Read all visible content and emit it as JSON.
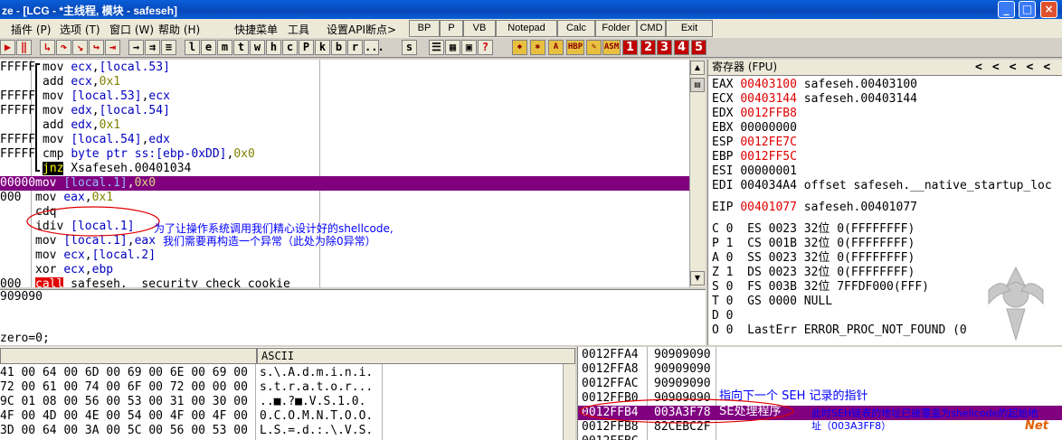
{
  "title": "ze - [LCG - *主线程, 模块 - safeseh]",
  "window_buttons": {
    "min": "_",
    "max": "□",
    "close": "×"
  },
  "menu": [
    "插件 (P)",
    "选项 (T)",
    "窗口 (W)",
    "帮助 (H)",
    "快捷菜单",
    "工具",
    "设置API断点>"
  ],
  "menu_buttons": [
    "BP",
    "P",
    "VB",
    "Notepad",
    "Calc",
    "Folder",
    "CMD",
    "Exit"
  ],
  "toolbar": {
    "letters": [
      "l",
      "e",
      "m",
      "t",
      "w",
      "h",
      "c",
      "P",
      "k",
      "b",
      "r",
      "...",
      "s"
    ],
    "plugins": [
      "HBP",
      "ASM"
    ],
    "numbers": [
      "1",
      "2",
      "3",
      "4",
      "5"
    ]
  },
  "disasm": [
    {
      "addr": "FFFFF",
      "tokens": [
        [
          "mov ",
          "blk"
        ],
        [
          "ecx",
          "blu"
        ],
        [
          ",",
          "blk"
        ],
        [
          "[local.53]",
          "blu"
        ]
      ]
    },
    {
      "addr": "",
      "tokens": [
        [
          "add ",
          "blk"
        ],
        [
          "ecx",
          "blu"
        ],
        [
          ",",
          "blk"
        ],
        [
          "0x1",
          "olv"
        ]
      ]
    },
    {
      "addr": "FFFFF",
      "tokens": [
        [
          "mov ",
          "blk"
        ],
        [
          "[local.53]",
          "blu"
        ],
        [
          ",",
          "blk"
        ],
        [
          "ecx",
          "blu"
        ]
      ]
    },
    {
      "addr": "FFFFF",
      "tokens": [
        [
          "mov ",
          "blk"
        ],
        [
          "edx",
          "blu"
        ],
        [
          ",",
          "blk"
        ],
        [
          "[local.54]",
          "blu"
        ]
      ]
    },
    {
      "addr": "",
      "tokens": [
        [
          "add ",
          "blk"
        ],
        [
          "edx",
          "blu"
        ],
        [
          ",",
          "blk"
        ],
        [
          "0x1",
          "olv"
        ]
      ]
    },
    {
      "addr": "FFFFF",
      "tokens": [
        [
          "mov ",
          "blk"
        ],
        [
          "[local.54]",
          "blu"
        ],
        [
          ",",
          "blk"
        ],
        [
          "edx",
          "blu"
        ]
      ]
    },
    {
      "addr": "FFFFF",
      "tokens": [
        [
          "cmp ",
          "blk"
        ],
        [
          "byte ptr ss:[ebp-0xDD]",
          "blu"
        ],
        [
          ",",
          "blk"
        ],
        [
          "0x0",
          "olv"
        ]
      ]
    },
    {
      "addr": "",
      "tokens": [
        [
          "jnz",
          "jnz"
        ],
        [
          " Xsafeseh.00401034",
          "blk"
        ]
      ]
    },
    {
      "addr": "00000",
      "tokens": [
        [
          "mov ",
          "blk"
        ],
        [
          "[local.1]",
          "blu"
        ],
        [
          ",",
          "blk"
        ],
        [
          "0x0",
          "olv"
        ]
      ],
      "sel": true
    },
    {
      "addr": "000",
      "tokens": [
        [
          "mov ",
          "blk"
        ],
        [
          "eax",
          "blu"
        ],
        [
          ",",
          "blk"
        ],
        [
          "0x1",
          "olv"
        ]
      ]
    },
    {
      "addr": "",
      "tokens": [
        [
          "cdq",
          "blk"
        ]
      ]
    },
    {
      "addr": "",
      "tokens": [
        [
          "idiv ",
          "blk"
        ],
        [
          "[local.1]",
          "blu"
        ]
      ]
    },
    {
      "addr": "",
      "tokens": [
        [
          "mov ",
          "blk"
        ],
        [
          "[local.1]",
          "blu"
        ],
        [
          ",",
          "blk"
        ],
        [
          "eax",
          "blu"
        ]
      ]
    },
    {
      "addr": "",
      "tokens": [
        [
          "mov ",
          "blk"
        ],
        [
          "ecx",
          "blu"
        ],
        [
          ",",
          "blk"
        ],
        [
          "[local.2]",
          "blu"
        ]
      ]
    },
    {
      "addr": "",
      "tokens": [
        [
          "xor ",
          "blk"
        ],
        [
          "ecx",
          "blu"
        ],
        [
          ",",
          "blk"
        ],
        [
          "ebp",
          "blu"
        ]
      ]
    },
    {
      "addr": "000",
      "tokens": [
        [
          "call",
          "call"
        ],
        [
          " safeseh.__security_check_cookie",
          "blk"
        ]
      ]
    }
  ],
  "annotations": {
    "idiv_note_1": "为了让操作系统调用我们精心设计好的shellcode,",
    "idiv_note_2": "我们需要再构造一个异常（此处为除0异常）",
    "seh_next": "指向下一个 SEH 记录的指针",
    "seh_handler": "SE处理程序",
    "seh_note_1": "此时SEH链表的地址已被覆盖为shellcode的起始地",
    "seh_note_2": "址（003A3FF8）"
  },
  "info_pane": {
    "line1": "909090",
    "line2": "zero=0;"
  },
  "registers": {
    "header": "寄存器 (FPU)",
    "nav": [
      "<",
      "<",
      "<",
      "<",
      "<"
    ],
    "rows": [
      {
        "name": "EAX",
        "value": "00403100",
        "changed": true,
        "comment": "safeseh.00403100"
      },
      {
        "name": "ECX",
        "value": "00403144",
        "changed": true,
        "comment": "safeseh.00403144"
      },
      {
        "name": "EDX",
        "value": "0012FFB8",
        "changed": true,
        "comment": ""
      },
      {
        "name": "EBX",
        "value": "00000000",
        "changed": false,
        "comment": ""
      },
      {
        "name": "ESP",
        "value": "0012FE7C",
        "changed": true,
        "comment": ""
      },
      {
        "name": "EBP",
        "value": "0012FF5C",
        "changed": true,
        "comment": ""
      },
      {
        "name": "ESI",
        "value": "00000001",
        "changed": false,
        "comment": ""
      },
      {
        "name": "EDI",
        "value": "004034A4",
        "changed": false,
        "comment": "offset safeseh.__native_startup_loc"
      }
    ],
    "eip": {
      "name": "EIP",
      "value": "00401077",
      "comment": "safeseh.00401077"
    },
    "flags": [
      "C 0  ES 0023 32位 0(FFFFFFFF)",
      "P 1  CS 001B 32位 0(FFFFFFFF)",
      "A 0  SS 0023 32位 0(FFFFFFFF)",
      "Z 1  DS 0023 32位 0(FFFFFFFF)",
      "S 0  FS 003B 32位 7FFDF000(FFF)",
      "T 0  GS 0000 NULL",
      "D 0",
      "O 0  LastErr ERROR_PROC_NOT_FOUND (0"
    ]
  },
  "dump": {
    "ascii_header": "ASCII",
    "rows": [
      {
        "hex": "41 00 64 00 6D 00 69 00 6E 00 69 00",
        "ascii": "s.\\.A.d.m.i.n.i."
      },
      {
        "hex": "72 00 61 00 74 00 6F 00 72 00 00 00",
        "ascii": "s.t.r.a.t.o.r..."
      },
      {
        "hex": "9C 01 08 00 56 00 53 00 31 00 30 00",
        "ascii": "..■.?■.V.S.1.0."
      },
      {
        "hex": "4F 00 4D 00 4E 00 54 00 4F 00 4F 00",
        "ascii": "0.C.O.M.N.T.O.O."
      },
      {
        "hex": "3D 00 64 00 3A 00 5C 00 56 00 53 00",
        "ascii": "L.S.=.d.:.\\.V.S."
      }
    ]
  },
  "stack": [
    {
      "addr": "0012FFA4",
      "value": "90909090"
    },
    {
      "addr": "0012FFA8",
      "value": "90909090"
    },
    {
      "addr": "0012FFAC",
      "value": "90909090"
    },
    {
      "addr": "0012FFB0",
      "value": "90909090"
    },
    {
      "addr": "0012FFB4",
      "value": "003A3F78",
      "sel": true
    },
    {
      "addr": "0012FFB8",
      "value": "82CEBC2F"
    },
    {
      "addr": "0012FFBC",
      "value": ""
    }
  ],
  "watermark": "Net",
  "colors": {
    "select": "#800080",
    "title": "#0a5fd8",
    "changed": "#e00000",
    "note": "#0000ff"
  }
}
